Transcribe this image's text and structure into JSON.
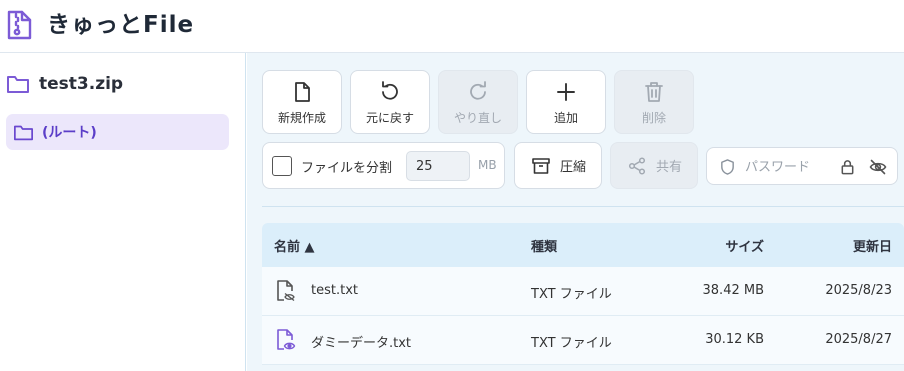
{
  "header": {
    "title": "きゅっとFile",
    "icon": "zip-file-icon",
    "accent": "#7c5bd6"
  },
  "sidebar": {
    "archive": {
      "name": "test3.zip",
      "icon": "folder-icon"
    },
    "items": [
      {
        "label": "(ルート)",
        "icon": "folder-icon",
        "selected": true
      }
    ]
  },
  "toolbar": {
    "new_label": "新規作成",
    "undo_label": "元に戻す",
    "redo_label": "やり直し",
    "add_label": "追加",
    "delete_label": "削除",
    "redo_disabled": true,
    "delete_disabled": true
  },
  "options": {
    "split_label": "ファイルを分割",
    "split_checked": false,
    "split_size": "25",
    "split_unit": "MB",
    "compress_label": "圧縮",
    "share_label": "共有",
    "share_disabled": true,
    "password_placeholder": "パスワード"
  },
  "table": {
    "headers": {
      "name": "名前 ▲",
      "type": "種類",
      "size": "サイズ",
      "date": "更新日"
    },
    "rows": [
      {
        "name": "test.txt",
        "type": "TXT ファイル",
        "size": "38.42 MB",
        "date": "2025/8/23",
        "icon": "file-hidden-icon"
      },
      {
        "name": "ダミーデータ.txt",
        "type": "TXT ファイル",
        "size": "30.12 KB",
        "date": "2025/8/27",
        "icon": "file-visible-icon"
      }
    ]
  }
}
